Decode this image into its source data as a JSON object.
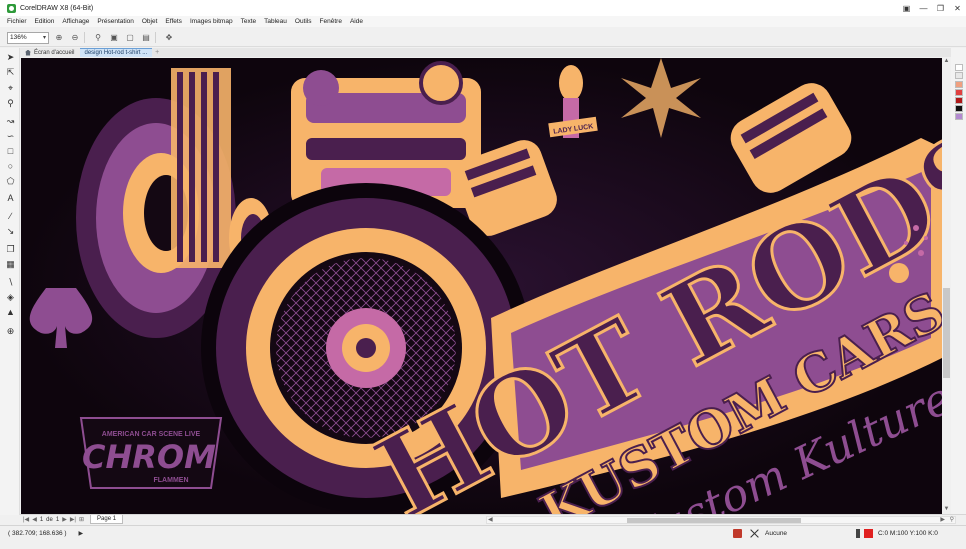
{
  "window": {
    "title": "CorelDRAW X8 (64-Bit)"
  },
  "menu": [
    "Fichier",
    "Edition",
    "Affichage",
    "Présentation",
    "Objet",
    "Effets",
    "Images bitmap",
    "Texte",
    "Tableau",
    "Outils",
    "Fenêtre",
    "Aide"
  ],
  "toolbar": {
    "zoom_value": "136%",
    "icons": [
      "zoom-in-icon",
      "zoom-out-icon",
      "zoom-selected-icon",
      "zoom-all-icon",
      "zoom-page-icon",
      "zoom-width-icon",
      "pan-icon"
    ]
  },
  "tabs": [
    {
      "label": "Écran d'accueil",
      "icon": "home-icon"
    },
    {
      "label": "design Hot-rod t-shirt ..."
    }
  ],
  "tools": [
    "pick-tool-icon",
    "shape-tool-icon",
    "crop-tool-icon",
    "zoom-tool-icon",
    "freehand-tool-icon",
    "artistic-media-icon",
    "rectangle-tool-icon",
    "ellipse-tool-icon",
    "polygon-tool-icon",
    "text-tool-icon",
    "parallel-dimension-icon",
    "connector-tool-icon",
    "drop-shadow-icon",
    "transparency-icon",
    "eyedropper-icon",
    "interactive-fill-icon",
    "smart-fill-icon",
    "add-tool-icon"
  ],
  "artwork": {
    "headline": "HOT RODS",
    "subhead": "KUSTOM CARS",
    "script_text": "Kustom Kulture",
    "badge_line1": "AMERICAN CAR SCENE LIVE",
    "badge_main": "CHROM",
    "badge_line2": "FLAMMEN",
    "pinup_label": "LADY LUCK",
    "colors": {
      "background": "#140813",
      "orange": "#f7b46a",
      "purple": "#8e4d91",
      "dark_purple": "#4a1f4e",
      "pink": "#c56aa6"
    }
  },
  "page_nav": {
    "current": "1",
    "of_label": "de",
    "total": "1",
    "page_tab": "Page 1"
  },
  "status": {
    "coordinates": "( 382.709; 168.636 )",
    "fill_label": "Aucune",
    "outline_label": "C:0 M:100 Y:100 K:0"
  },
  "palette": [
    "#ffffff",
    "#e8e8e8",
    "#f0a080",
    "#e04040",
    "#b01818",
    "#101010",
    "#b38ad0"
  ]
}
